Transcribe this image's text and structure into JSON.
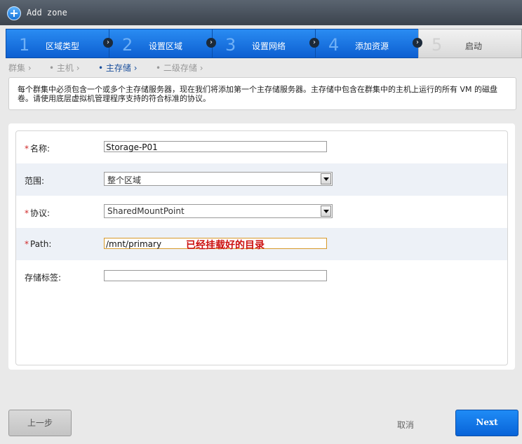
{
  "window": {
    "title": "Add zone"
  },
  "steps": [
    {
      "num": "1",
      "label": "区域类型"
    },
    {
      "num": "2",
      "label": "设置区域"
    },
    {
      "num": "3",
      "label": "设置网络"
    },
    {
      "num": "4",
      "label": "添加资源"
    },
    {
      "num": "5",
      "label": "启动"
    }
  ],
  "breadcrumb": [
    {
      "label": "群集 ›"
    },
    {
      "label": "• 主机 ›"
    },
    {
      "label": "• 主存储 ›"
    },
    {
      "label": "• 二级存储 ›"
    }
  ],
  "description": "每个群集中必须包含一个或多个主存储服务器，现在我们将添加第一个主存储服务器。主存储中包含在群集中的主机上运行的所有 VM 的磁盘卷。请使用底层虚拟机管理程序支持的符合标准的协议。",
  "form": {
    "name_label": "名称:",
    "name_value": "Storage-P01",
    "scope_label": "范围:",
    "scope_value": "整个区域",
    "protocol_label": "协议:",
    "protocol_value": "SharedMountPoint",
    "path_label": "Path:",
    "path_value": "/mnt/primary",
    "path_annotation": "已经挂载好的目录",
    "tags_label": "存储标签:",
    "tags_value": "",
    "required_mark": "*"
  },
  "footer": {
    "back": "上一步",
    "cancel": "取消",
    "next": "Next"
  },
  "colors": {
    "accent": "#0d5fd1",
    "required": "#d02a2a",
    "annotation": "#cc1111"
  }
}
